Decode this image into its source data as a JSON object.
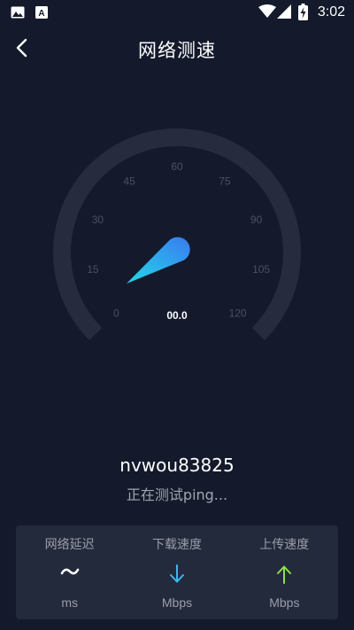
{
  "status_bar": {
    "time": "3:02",
    "left_icons": [
      "image-icon",
      "font-icon"
    ],
    "right_icons": [
      "wifi-icon",
      "signal-icon",
      "battery-icon"
    ]
  },
  "header": {
    "title": "网络测速",
    "back_icon": "chevron-left-icon"
  },
  "gauge": {
    "ticks": [
      "0",
      "15",
      "30",
      "45",
      "60",
      "75",
      "90",
      "105",
      "120"
    ],
    "speed_value": "00.0",
    "current_value": 0
  },
  "server": {
    "name": "nvwou83825",
    "status": "正在测试ping..."
  },
  "results": [
    {
      "label": "网络延迟",
      "icon": "tilde-icon",
      "unit": "ms"
    },
    {
      "label": "下载速度",
      "icon": "arrow-down-icon",
      "unit": "Mbps"
    },
    {
      "label": "上传速度",
      "icon": "arrow-up-icon",
      "unit": "Mbps"
    }
  ],
  "colors": {
    "background": "#141a2c",
    "panel": "#232a3c",
    "download_accent": "#3ab8f0",
    "upload_accent": "#8ee04a",
    "needle_start": "#22d8e8",
    "needle_end": "#3a7bf0"
  }
}
